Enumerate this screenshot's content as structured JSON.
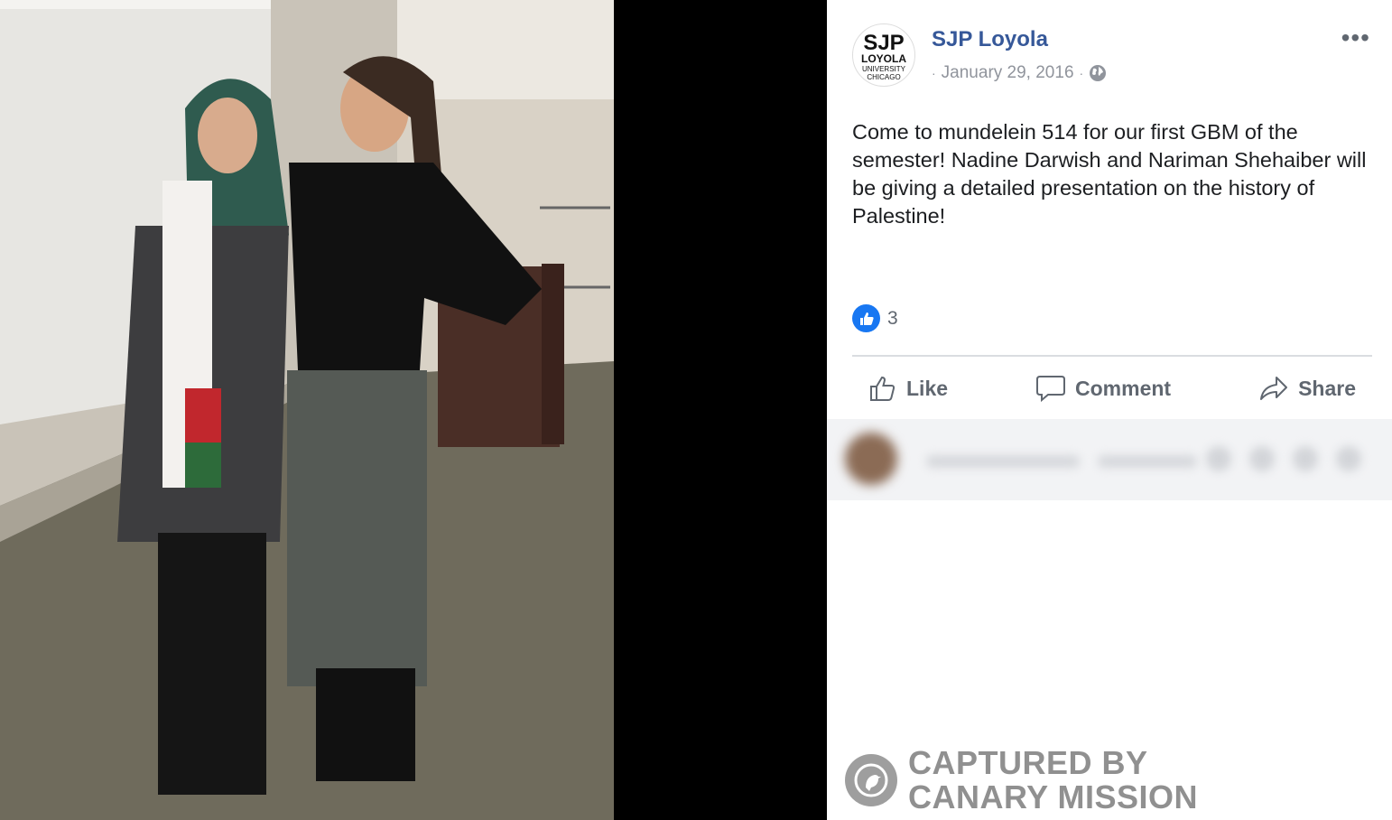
{
  "post": {
    "page_name": "SJP Loyola",
    "date": "January 29, 2016",
    "separator": "·",
    "text": "Come to mundelein 514 for our first GBM of the semester! Nadine Darwish and Nariman Shehaiber will be giving a detailed presentation on the history of Palestine!",
    "reaction_count": "3"
  },
  "avatar": {
    "line1": "SJP",
    "line2": "LOYOLA",
    "line3": "UNIVERSITY",
    "line4": "CHICAGO"
  },
  "actions": {
    "like": "Like",
    "comment": "Comment",
    "share": "Share"
  },
  "watermark": {
    "line1": "CAPTURED BY",
    "line2": "CANARY MISSION"
  },
  "colors": {
    "link_blue": "#365899",
    "reaction_blue": "#1877f2",
    "muted_text": "#606770"
  },
  "icons": [
    "globe-icon",
    "more-icon",
    "like-reaction-icon",
    "thumbs-up-icon",
    "comment-icon",
    "share-icon",
    "canary-icon"
  ]
}
